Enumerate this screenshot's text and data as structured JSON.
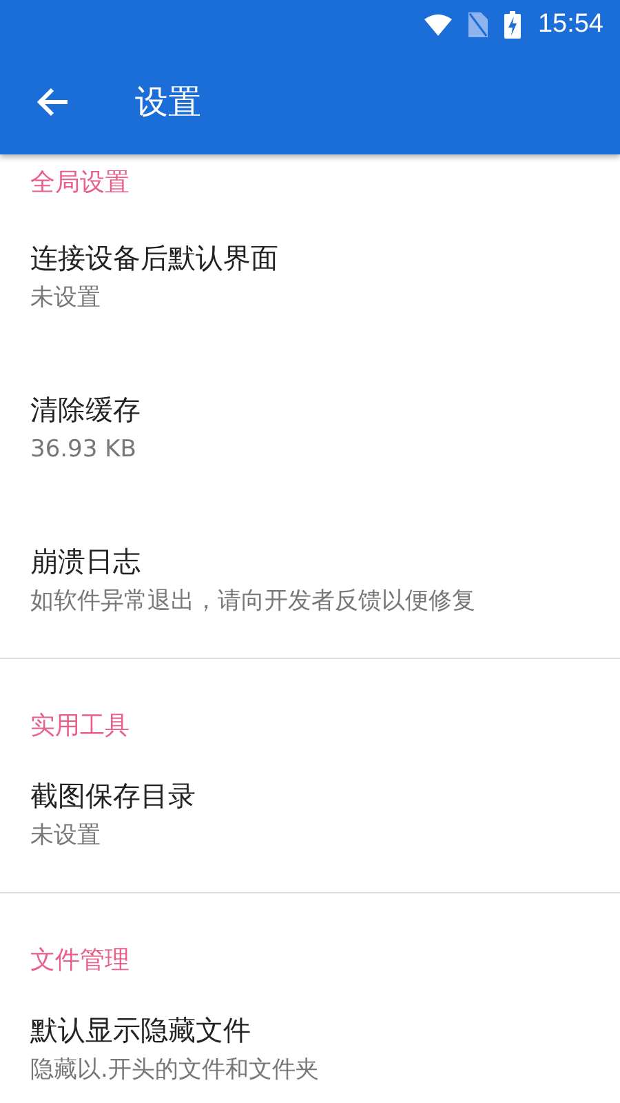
{
  "status_bar": {
    "time": "15:54"
  },
  "app_bar": {
    "title": "设置"
  },
  "sections": [
    {
      "title": "全局设置",
      "items": [
        {
          "title": "连接设备后默认界面",
          "summary": "未设置"
        },
        {
          "title": "清除缓存",
          "summary": "36.93 KB"
        },
        {
          "title": "崩溃日志",
          "summary": "如软件异常退出，请向开发者反馈以便修复"
        }
      ]
    },
    {
      "title": "实用工具",
      "items": [
        {
          "title": "截图保存目录",
          "summary": "未设置"
        }
      ]
    },
    {
      "title": "文件管理",
      "items": [
        {
          "title": "默认显示隐藏文件",
          "summary": "隐藏以.开头的文件和文件夹"
        }
      ]
    }
  ]
}
